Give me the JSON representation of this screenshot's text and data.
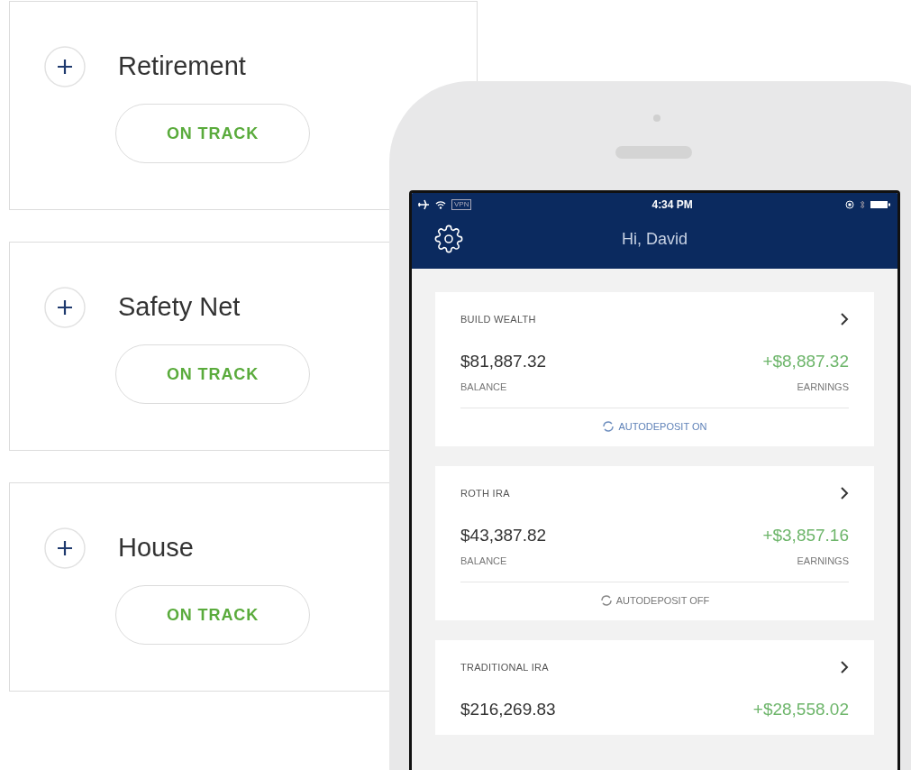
{
  "goals": [
    {
      "name": "Retirement",
      "status": "ON TRACK"
    },
    {
      "name": "Safety Net",
      "status": "ON TRACK"
    },
    {
      "name": "House",
      "status": "ON TRACK"
    }
  ],
  "phone": {
    "status_bar": {
      "network": "VPN",
      "time": "4:34 PM"
    },
    "header": {
      "title": "Hi, David"
    },
    "accounts": [
      {
        "name": "BUILD WEALTH",
        "balance": "$81,887.32",
        "balance_label": "BALANCE",
        "earnings": "+$8,887.32",
        "earnings_label": "EARNINGS",
        "autodeposit": {
          "label": "AUTODEPOSIT ON",
          "on": true
        }
      },
      {
        "name": "ROTH IRA",
        "balance": "$43,387.82",
        "balance_label": "BALANCE",
        "earnings": "+$3,857.16",
        "earnings_label": "EARNINGS",
        "autodeposit": {
          "label": "AUTODEPOSIT OFF",
          "on": false
        }
      },
      {
        "name": "TRADITIONAL IRA",
        "balance": "$216,269.83",
        "earnings": "+$28,558.02"
      }
    ]
  }
}
